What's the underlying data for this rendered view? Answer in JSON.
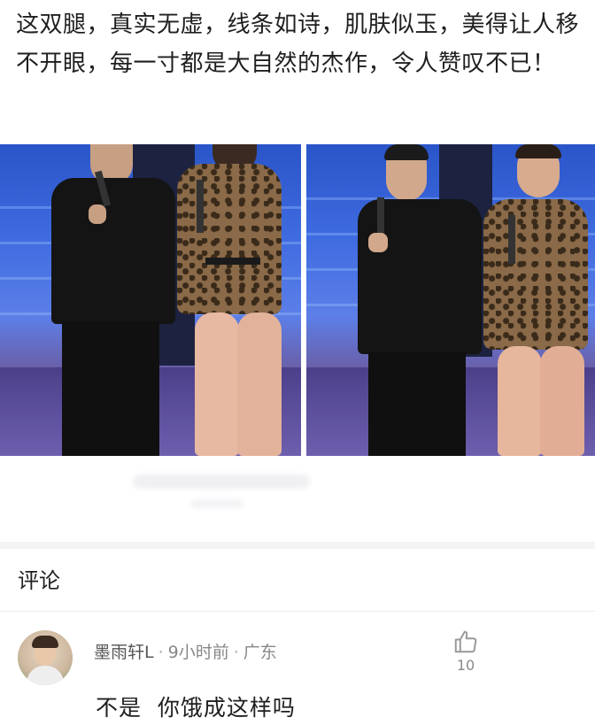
{
  "post": {
    "text": "这双腿，真实无虚，线条如诗，肌肤似玉，美得让人移不开眼，每一寸都是大自然的杰作，令人赞叹不已！"
  },
  "images": {
    "left_alt": "stage photo: man in black shirt with microphone beside woman in leopard-print outfit",
    "right_alt": "stage photo: man in black shirt and woman in leopard-print outfit holding microphones"
  },
  "comments": {
    "title": "评论",
    "items": [
      {
        "username": "墨雨轩L",
        "time": "9小时前",
        "location": "广东",
        "like_count": "10",
        "text": "不是  你饿成这样吗"
      }
    ]
  },
  "colors": {
    "stage_blue": "#3f6be0",
    "stage_purple": "#6e5fae",
    "text_primary": "#1f1f1f",
    "text_meta": "#888888"
  }
}
